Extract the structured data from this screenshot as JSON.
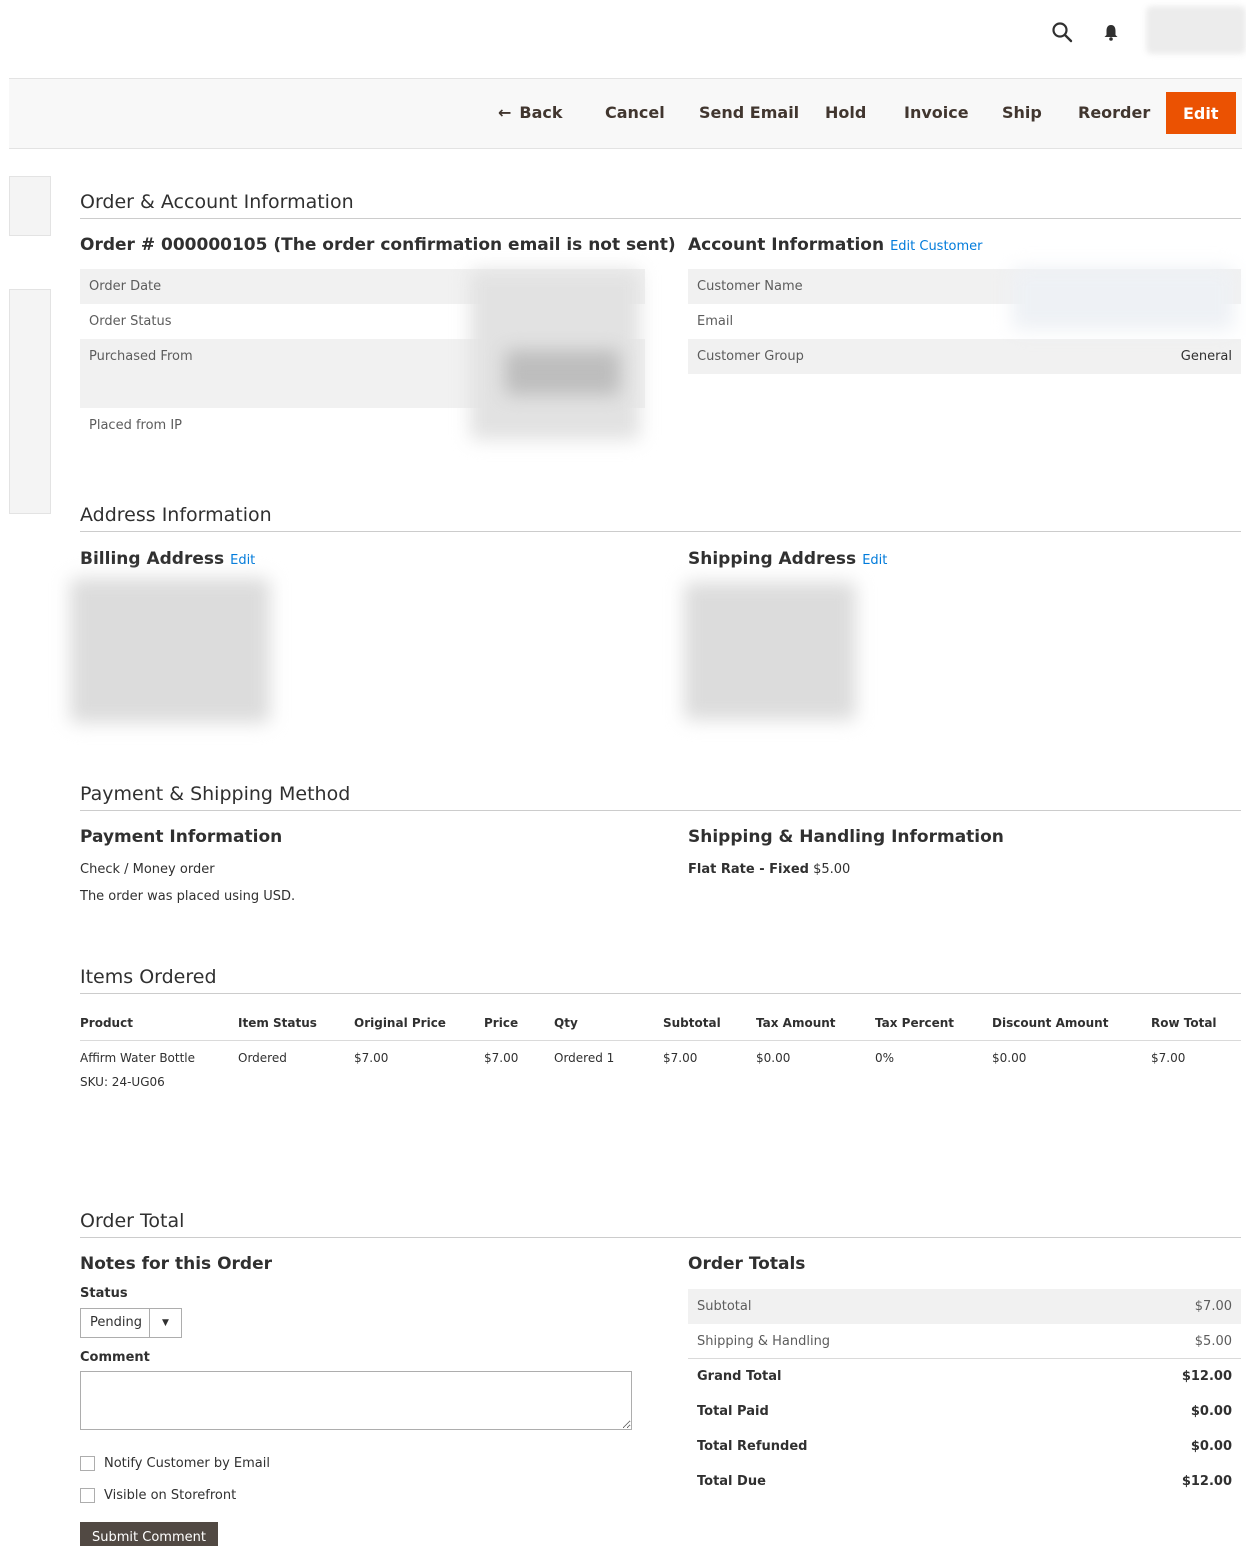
{
  "header": {
    "search_icon": "search-icon",
    "notifications_icon": "bell-icon"
  },
  "actions": {
    "back": "Back",
    "cancel": "Cancel",
    "send_email": "Send Email",
    "hold": "Hold",
    "invoice": "Invoice",
    "ship": "Ship",
    "reorder": "Reorder",
    "edit": "Edit",
    "accent_color": "#eb5202"
  },
  "order_account": {
    "section_title": "Order & Account Information",
    "order_title": "Order # 000000105 (The order confirmation email is not sent)",
    "order_rows": [
      {
        "label": "Order Date"
      },
      {
        "label": "Order Status"
      },
      {
        "label": "Purchased From"
      },
      {
        "label": "Placed from IP"
      }
    ],
    "account_title": "Account Information",
    "edit_customer": "Edit Customer",
    "account_rows": [
      {
        "label": "Customer Name",
        "value": ""
      },
      {
        "label": "Email",
        "value": ""
      },
      {
        "label": "Customer Group",
        "value": "General"
      }
    ]
  },
  "address": {
    "section_title": "Address Information",
    "billing_title": "Billing Address",
    "billing_edit": "Edit",
    "shipping_title": "Shipping Address",
    "shipping_edit": "Edit"
  },
  "payment_shipping": {
    "section_title": "Payment & Shipping Method",
    "payment_title": "Payment Information",
    "payment_method": "Check / Money order",
    "currency_note": "The order was placed using USD.",
    "shipping_title": "Shipping & Handling Information",
    "shipping_method": "Flat Rate - Fixed",
    "shipping_price": "$5.00"
  },
  "items": {
    "section_title": "Items Ordered",
    "columns": [
      "Product",
      "Item Status",
      "Original Price",
      "Price",
      "Qty",
      "Subtotal",
      "Tax Amount",
      "Tax Percent",
      "Discount Amount",
      "Row Total"
    ],
    "rows": [
      {
        "product": "Affirm Water Bottle",
        "sku": "SKU: 24-UG06",
        "item_status": "Ordered",
        "original_price": "$7.00",
        "price": "$7.00",
        "qty": "Ordered 1",
        "subtotal": "$7.00",
        "tax_amount": "$0.00",
        "tax_percent": "0%",
        "discount_amount": "$0.00",
        "row_total": "$7.00"
      }
    ]
  },
  "order_total": {
    "section_title": "Order Total",
    "notes_title": "Notes for this Order",
    "status_label": "Status",
    "status_value": "Pending",
    "comment_label": "Comment",
    "notify_label": "Notify Customer by Email",
    "visible_label": "Visible on Storefront",
    "submit_label": "Submit Comment",
    "totals_title": "Order Totals",
    "totals": [
      {
        "label": "Subtotal",
        "value": "$7.00"
      },
      {
        "label": "Shipping & Handling",
        "value": "$5.00"
      },
      {
        "label": "Grand Total",
        "value": "$12.00"
      },
      {
        "label": "Total Paid",
        "value": "$0.00"
      },
      {
        "label": "Total Refunded",
        "value": "$0.00"
      },
      {
        "label": "Total Due",
        "value": "$12.00"
      }
    ]
  }
}
